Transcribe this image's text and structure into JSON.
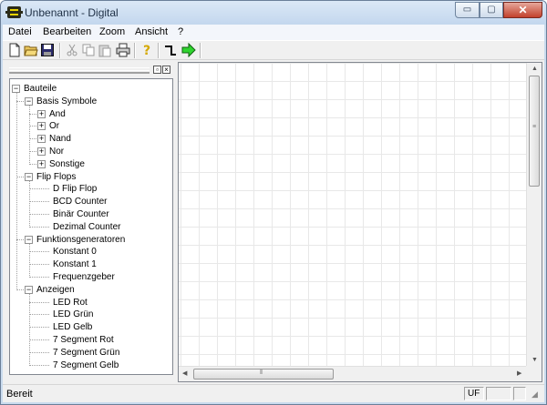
{
  "window": {
    "title": "Unbenannt - Digital",
    "min_label": "▭",
    "max_label": "▢",
    "close_label": "✕"
  },
  "menu": [
    "Datei",
    "Bearbeiten",
    "Zoom",
    "Ansicht",
    "?"
  ],
  "toolbar": {
    "icons": [
      "new-document-icon",
      "open-folder-icon",
      "save-disk-icon",
      "cut-scissors-icon",
      "copy-icon",
      "paste-icon",
      "print-icon",
      "help-question-icon",
      "wire-tool-icon",
      "run-simulation-icon"
    ]
  },
  "panel": {
    "pin_label": "▫",
    "close_label": "×"
  },
  "tree": {
    "root": "Bauteile",
    "groups": [
      {
        "label": "Basis Symbole",
        "children": [
          "And",
          "Or",
          "Nand",
          "Nor",
          "Sonstige"
        ],
        "children_expandable": true
      },
      {
        "label": "Flip Flops",
        "children": [
          "D Flip Flop",
          "BCD Counter",
          "Binär Counter",
          "Dezimal Counter"
        ],
        "children_expandable": false
      },
      {
        "label": "Funktionsgeneratoren",
        "children": [
          "Konstant 0",
          "Konstant 1",
          "Frequenzgeber"
        ],
        "children_expandable": false
      },
      {
        "label": "Anzeigen",
        "children": [
          "LED Rot",
          "LED Grün",
          "LED Gelb",
          "7 Segment Rot",
          "7 Segment Grün",
          "7 Segment Gelb"
        ],
        "children_expandable": false
      }
    ]
  },
  "statusbar": {
    "text": "Bereit",
    "pane1": "UF",
    "pane2": "",
    "pane3": ""
  },
  "colors": {
    "accent": "#c9dbee",
    "close": "#c2412c"
  }
}
